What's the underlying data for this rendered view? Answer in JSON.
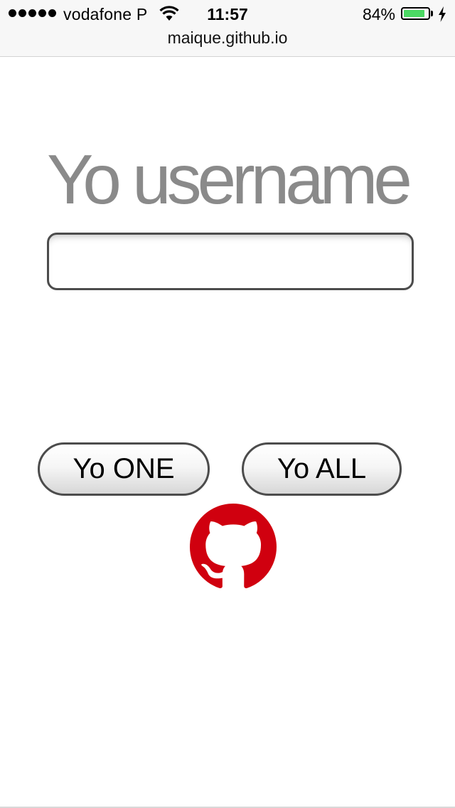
{
  "status_bar": {
    "carrier": "vodafone P",
    "time": "11:57",
    "battery_percent": "84%",
    "battery_level": 0.84,
    "signal_bars": 5,
    "charging": true
  },
  "browser": {
    "url": "maique.github.io"
  },
  "main": {
    "heading": "Yo username",
    "username_input": {
      "value": "",
      "placeholder": ""
    },
    "buttons": {
      "yo_one": "Yo ONE",
      "yo_all": "Yo ALL"
    },
    "github_icon": "github-octocat-icon"
  },
  "colors": {
    "heading": "#8a8a8a",
    "github_red": "#d0000f",
    "battery_fill": "#4cd964",
    "border": "#4c4c4c"
  }
}
